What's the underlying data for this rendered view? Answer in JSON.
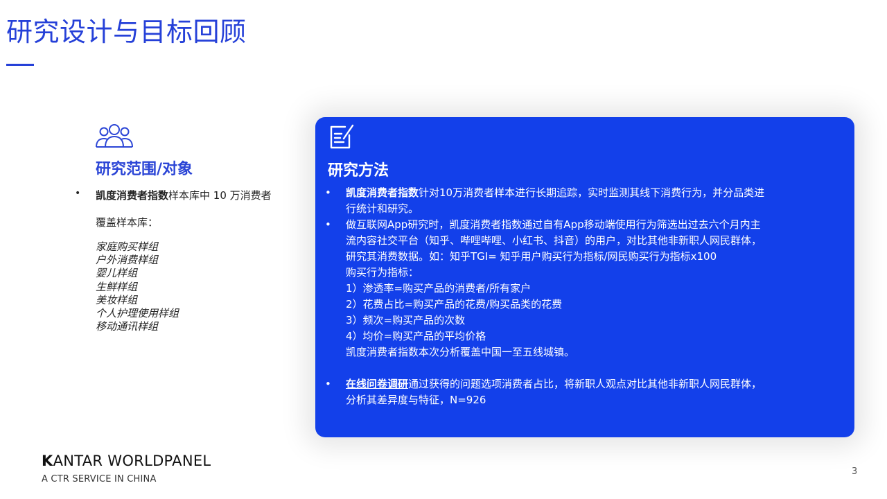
{
  "title": "研究设计与目标回顾",
  "left": {
    "icon": "people-group-icon",
    "heading": "研究范围/对象",
    "bullet_bold": "凯度消费者指数",
    "bullet_rest": "样本库中 10 万消费者",
    "coverage_label": "覆盖样本库：",
    "samples": [
      "家庭购买样组",
      "户外消费样组",
      "婴儿样组",
      "生鲜样组",
      "美妆样组",
      "个人护理使用样组",
      "移动通讯样组"
    ]
  },
  "card": {
    "icon": "edit-note-icon",
    "background": "#1340EA",
    "heading": "研究方法",
    "p1_bold": "凯度消费者指数",
    "p1_line1": "针对10万消费者样本进行长期追踪，实时监测其线下消费行为，并分品类进",
    "p1_line2": "行统计和研究。",
    "p2_lines": [
      "做互联网App研究时，凯度消费者指数通过自有App移动端使用行为筛选出过去六个月内主",
      "流内容社交平台（知乎、哔哩哔哩、小红书、抖音）的用户，对比其他非新职人网民群体，",
      "研究其消费数据。如：知乎TGI= 知乎用户购买行为指标/网民购买行为指标x100",
      "购买行为指标：",
      "1）渗透率=购买产品的消费者/所有家户",
      "2）花费占比=购买产品的花费/购买品类的花费",
      "3）频次=购买产品的次数",
      "4）均价=购买产品的平均价格",
      "凯度消费者指数本次分析覆盖中国一至五线城镇。"
    ],
    "p3_bold": "在线问卷调研",
    "p3_line1": "通过获得的问题选项消费者占比，将新职人观点对比其他非新职人网民群体，",
    "p3_line2": "分析其差异度与特征，N=926"
  },
  "footer": {
    "logo_k": "K",
    "logo_rest": "ANTAR WORLDPANEL",
    "logo_sub": "A CTR SERVICE IN CHINA",
    "page": "3"
  }
}
